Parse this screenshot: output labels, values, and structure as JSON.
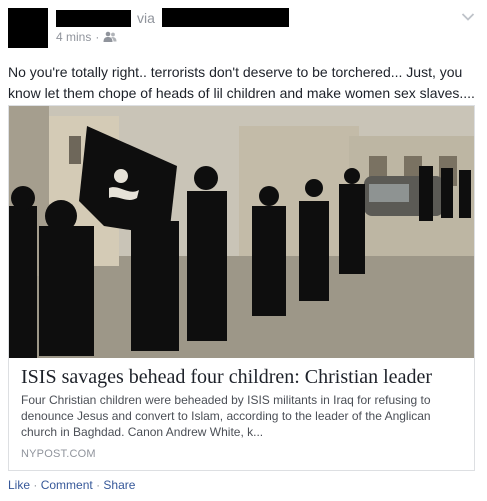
{
  "post": {
    "via_label": "via",
    "timestamp": "4 mins",
    "separator": "·",
    "privacy_icon": "friends-icon",
    "menu_icon": "chevron-down-icon",
    "status_text": "No you're totally right.. terrorists don't deserve to be torchered... Just, you know let them chope of heads of lil children and make women sex slaves...."
  },
  "card": {
    "title": "ISIS savages behead four children: Christian leader",
    "description": "Four Christian children were beheaded by ISIS militants in Iraq for refusing to denounce Jesus and convert to Islam, according to the leader of the Anglican church in Baghdad. Canon Andrew White, k...",
    "source": "NYPOST.COM"
  },
  "actions": {
    "like": "Like",
    "comment": "Comment",
    "share": "Share",
    "separator": "·"
  }
}
